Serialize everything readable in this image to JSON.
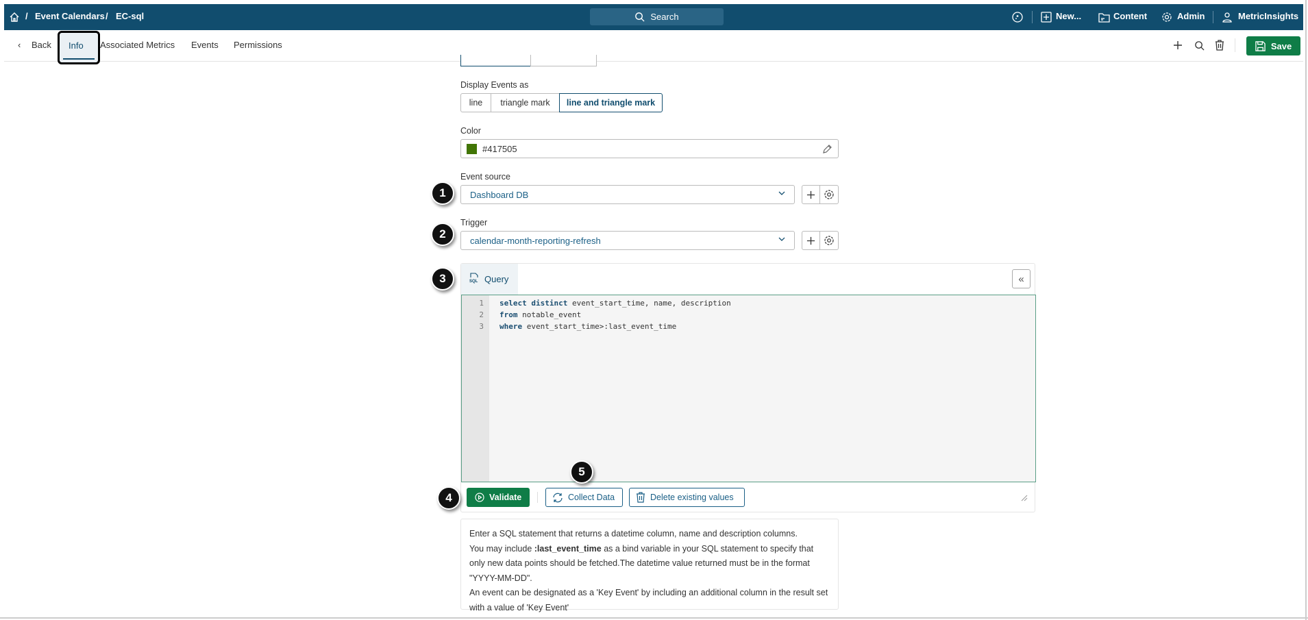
{
  "topbar": {
    "breadcrumb": [
      "Event Calendars",
      "EC-sql"
    ],
    "separator": "/",
    "search_label": "Search",
    "new_label": "New...",
    "content_label": "Content",
    "admin_label": "Admin",
    "user_label": "MetricInsights"
  },
  "tabs": {
    "back": "Back",
    "items": [
      "Info",
      "Associated Metrics",
      "Events",
      "Permissions"
    ],
    "active": "Info",
    "save_label": "Save"
  },
  "form": {
    "display_label": "Display Events as",
    "display_options": [
      "line",
      "triangle mark",
      "line and triangle mark"
    ],
    "display_selected": "line and triangle mark",
    "color_label": "Color",
    "color_value": "#417505",
    "event_source_label": "Event source",
    "event_source_value": "Dashboard DB",
    "trigger_label": "Trigger",
    "trigger_value": "calendar-month-reporting-refresh"
  },
  "editor": {
    "tab_label": "Query",
    "collapse_label": "«",
    "line_numbers": [
      "1",
      "2",
      "3"
    ],
    "lines": [
      [
        {
          "k": "select distinct"
        },
        {
          "t": " event_start_time, name, description"
        }
      ],
      [
        {
          "k": "from"
        },
        {
          "t": " notable_event"
        }
      ],
      [
        {
          "k": "where"
        },
        {
          "t": " event_start_time>:last_event_time"
        }
      ]
    ]
  },
  "actions": {
    "validate": "Validate",
    "collect": "Collect Data",
    "delete": "Delete existing values"
  },
  "help": {
    "l1": "Enter a SQL statement that returns a datetime column, name and description columns.",
    "l2a": "You may include ",
    "l2b": ":last_event_time",
    "l2c": " as a bind variable in your SQL statement to specify that only new data points should be fetched.The datetime value returned must be in the format \"YYYY-MM-DD\".",
    "l3": "An event can be designated as a 'Key Event' by including an additional column in the result set with a value of 'Key Event'"
  },
  "callouts": [
    "1",
    "2",
    "3",
    "4",
    "5"
  ],
  "colors": {
    "brand": "#114d6e",
    "save": "#0f7d47",
    "swatch": "#417505"
  }
}
